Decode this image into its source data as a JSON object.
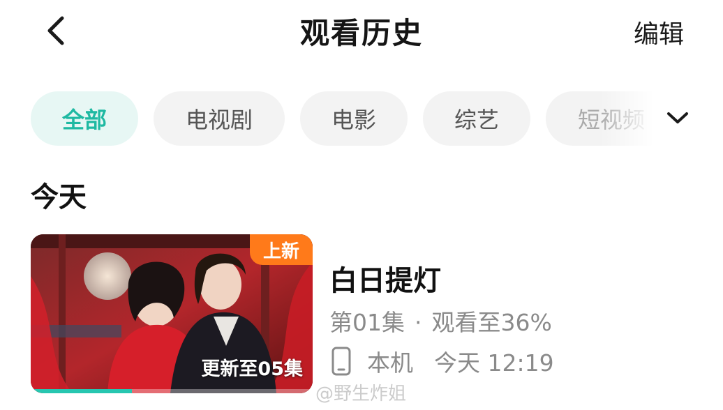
{
  "header": {
    "back_icon": "chevron-left-icon",
    "title": "观看历史",
    "edit_label": "编辑"
  },
  "tabs": [
    {
      "label": "全部",
      "active": true
    },
    {
      "label": "电视剧",
      "active": false
    },
    {
      "label": "电影",
      "active": false
    },
    {
      "label": "综艺",
      "active": false
    },
    {
      "label": "短视频",
      "active": false
    }
  ],
  "more_icon": "chevron-down-icon",
  "section": {
    "title": "今天"
  },
  "items": [
    {
      "badge": "上新",
      "update_label": "更新至05集",
      "title": "白日提灯",
      "episode": "第01集",
      "separator": "·",
      "progress_text": "观看至36%",
      "progress_fraction": 0.36,
      "device_icon": "phone-icon",
      "device": "本机",
      "time": "今天 12:19"
    }
  ],
  "watermark": "@野生炸姐",
  "colors": {
    "accent": "#1fb9a2",
    "accent_bg": "#e7f7f4",
    "badge": "#ff7a1a",
    "progress": "#27c6b0"
  }
}
